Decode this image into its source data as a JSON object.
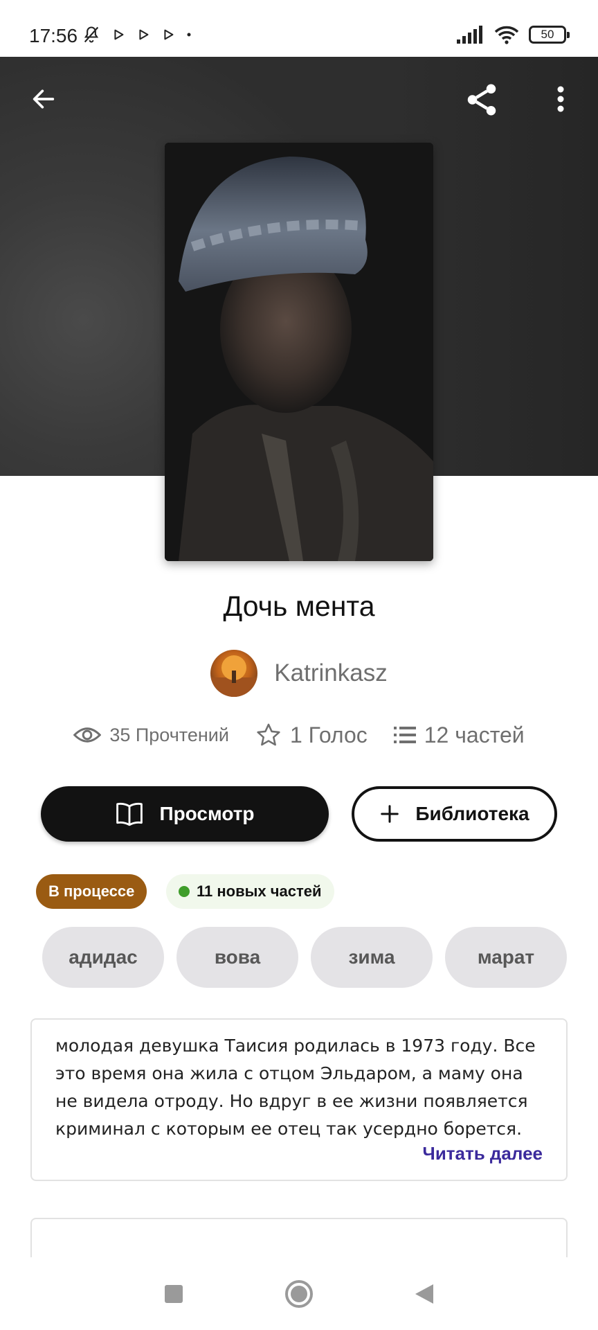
{
  "status_bar": {
    "time": "17:56",
    "battery": "50",
    "icons": [
      "bell-off-icon",
      "play-icon",
      "play-icon",
      "play-icon",
      "dot-icon",
      "signal-icon",
      "wifi-icon",
      "battery-icon"
    ]
  },
  "toolbar": {
    "back_icon": "arrow-left-icon",
    "share_icon": "share-icon",
    "menu_icon": "more-vertical-icon"
  },
  "story": {
    "title": "Дочь мента",
    "author": "Katrinkasz",
    "reads": "35 Прочтений",
    "votes": "1 Голос",
    "parts": "12 частей"
  },
  "actions": {
    "read_label": "Просмотр",
    "library_label": "Библиотека"
  },
  "badges": {
    "status": "В процессе",
    "new_parts": "11 новых частей"
  },
  "tags": [
    "адидас",
    "вова",
    "зима",
    "марат"
  ],
  "description": {
    "text": "молодая девушка Таисия родилась в 1973 году. Все это время она жила с отцом Эльдаром, а маму она не видела отроду. Но вдруг в ее жизни появляется криминал с которым ее отец так усердно борется.",
    "read_more": "Читать далее"
  },
  "colors": {
    "accent": "#3b2a9c",
    "status_badge": "#9a5b12",
    "new_dot": "#3f9d2a",
    "primary_button": "#121212"
  }
}
